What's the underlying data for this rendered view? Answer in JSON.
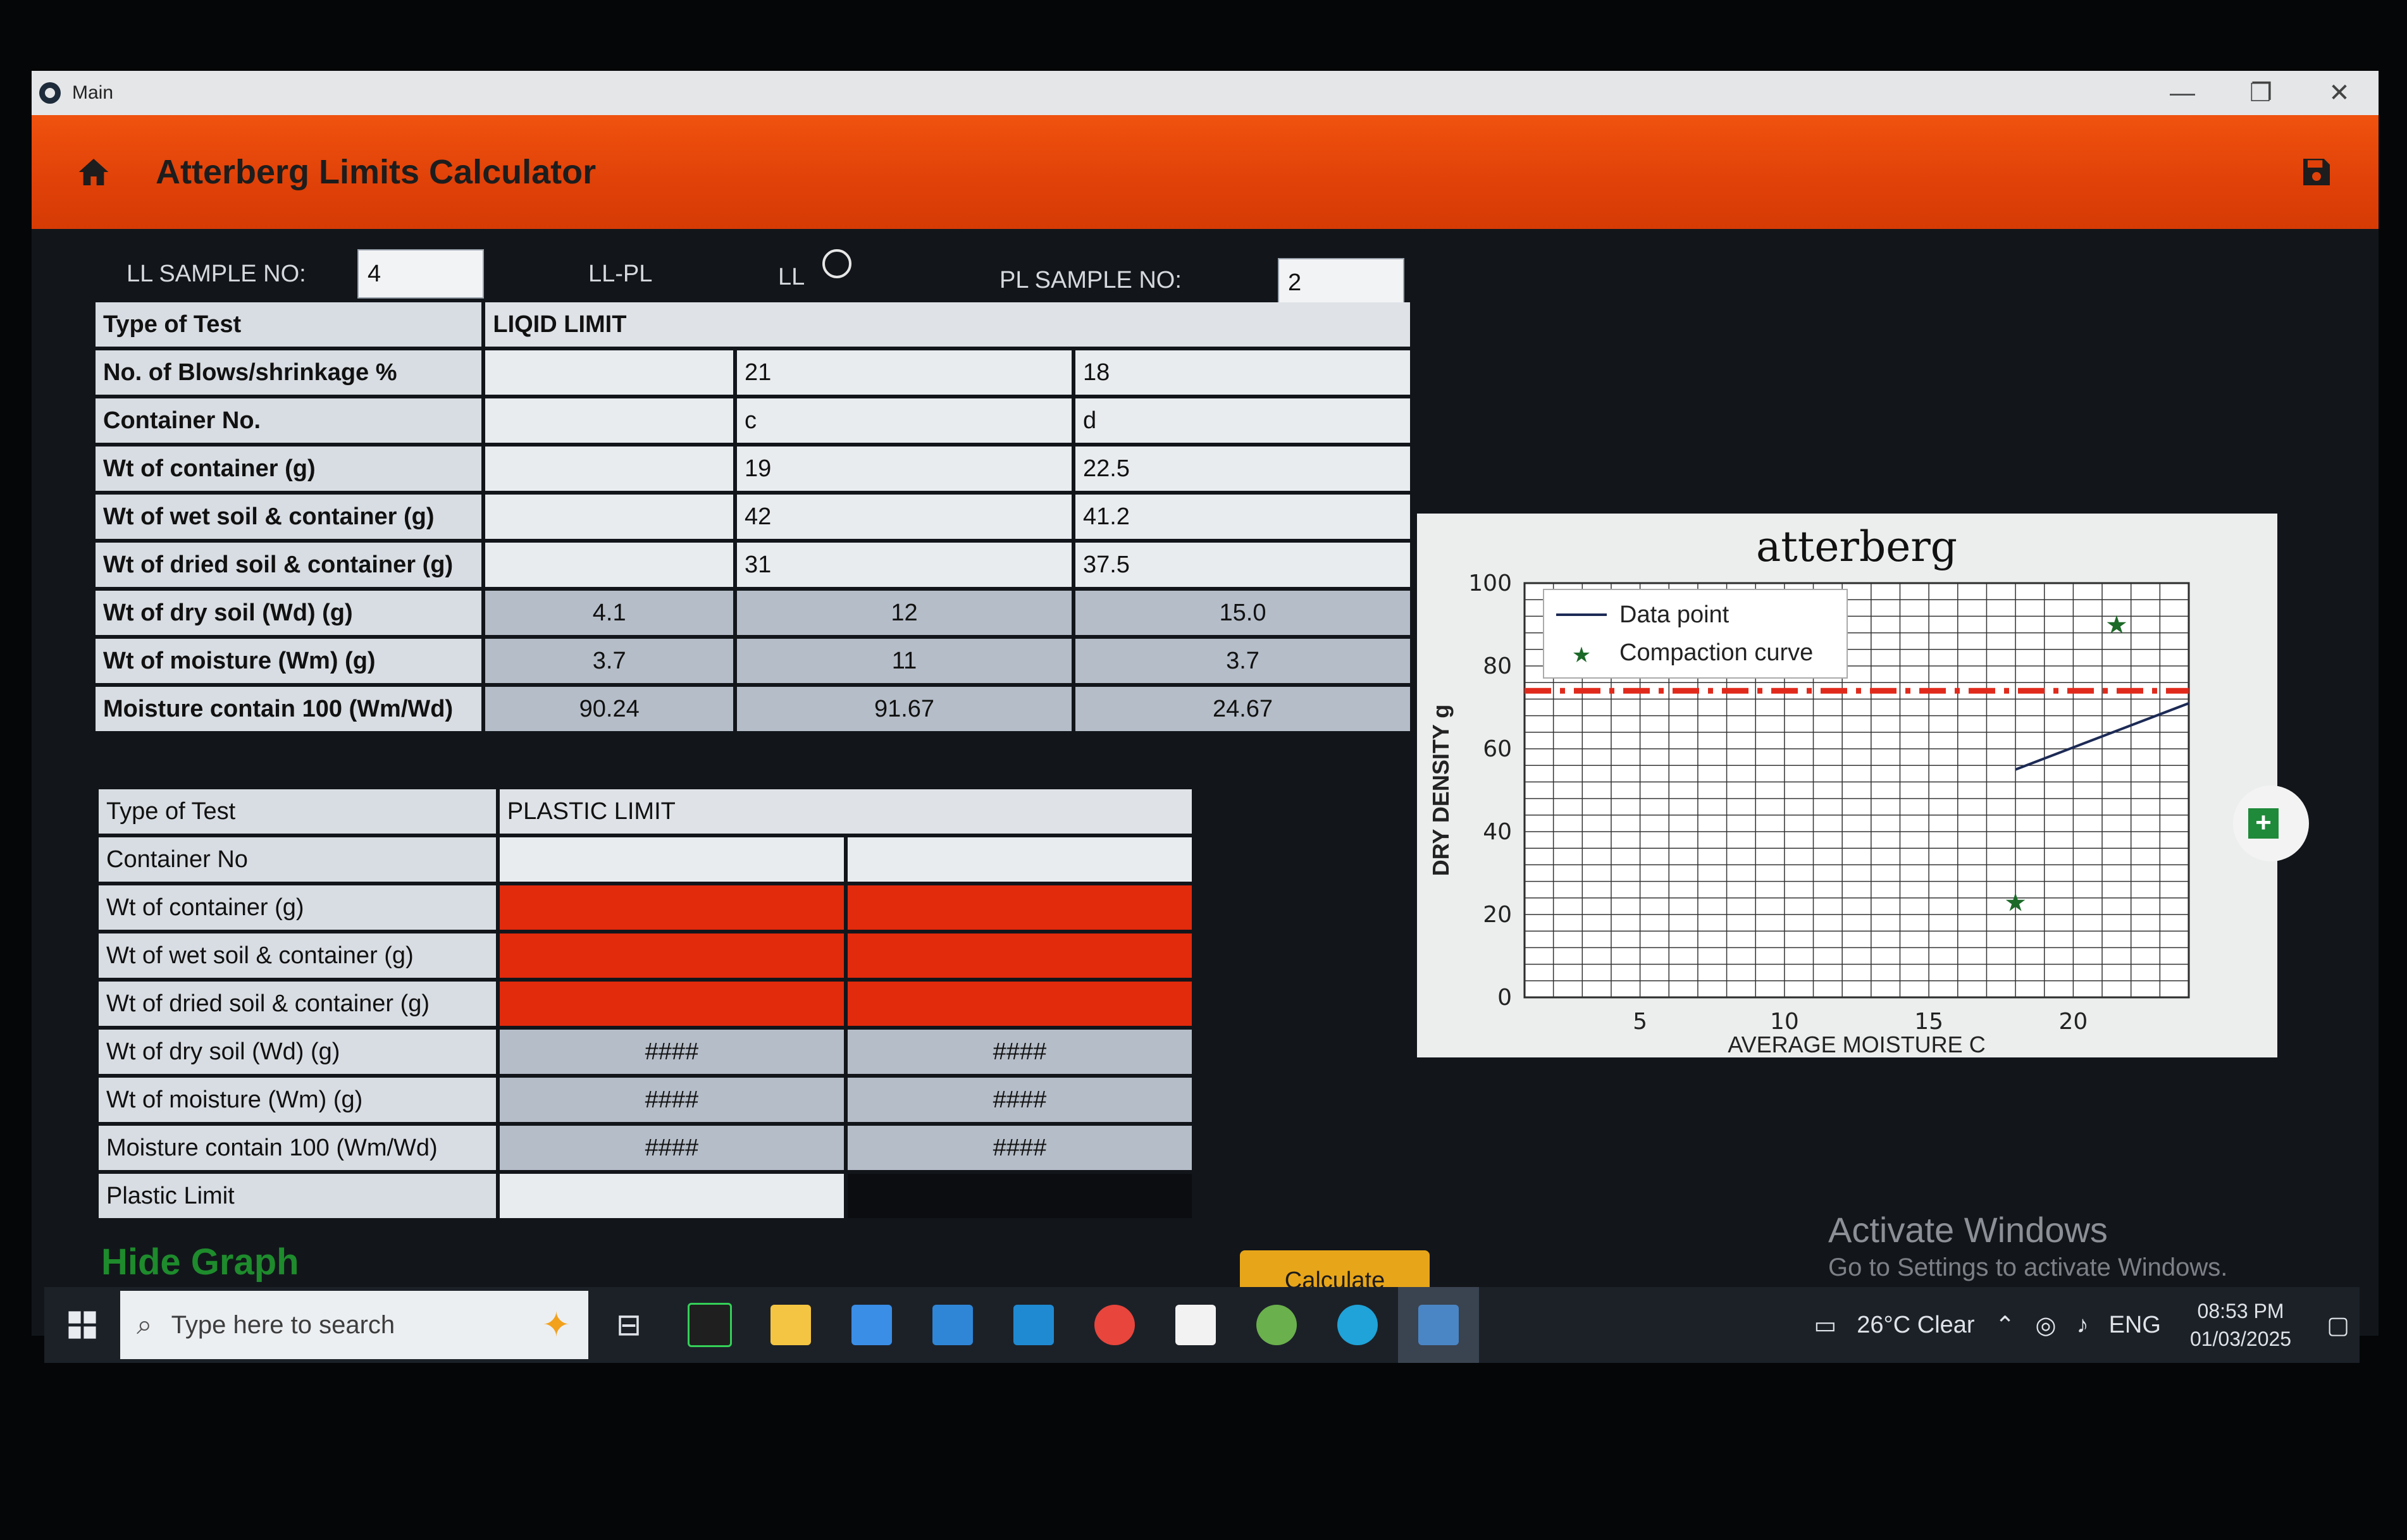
{
  "window": {
    "title": "Main",
    "controls": [
      "—",
      "❐",
      "✕"
    ]
  },
  "appbar": {
    "title": "Atterberg Limits Calculator",
    "home_icon": "home-icon",
    "save_icon": "save-icon",
    "accent_color": "#e04108"
  },
  "samples": {
    "ll_label": "LL SAMPLE NO:",
    "ll_value": "4",
    "mode_label": "LL-PL",
    "ll_radio_label": "LL",
    "pl_label": "PL SAMPLE NO:",
    "pl_value": "2"
  },
  "ll_table": {
    "type_label": "Type of Test",
    "type_value": "LIQID LIMIT",
    "rows": [
      {
        "label": "No. of Blows/shrinkage %",
        "values": [
          "",
          "21",
          "18"
        ]
      },
      {
        "label": "Container No.",
        "values": [
          "",
          "c",
          "d"
        ]
      },
      {
        "label": "Wt of container (g)",
        "values": [
          "",
          "19",
          "22.5"
        ]
      },
      {
        "label": "Wt of wet soil & container (g)",
        "values": [
          "",
          "42",
          "41.2"
        ]
      },
      {
        "label": "Wt of dried soil & container (g)",
        "values": [
          "",
          "31",
          "37.5"
        ]
      },
      {
        "label": "Wt of dry soil (Wd) (g)",
        "values": [
          "4.1",
          "12",
          "15.0"
        ]
      },
      {
        "label": "Wt of moisture (Wm) (g)",
        "values": [
          "3.7",
          "11",
          "3.7"
        ]
      },
      {
        "label": "Moisture contain 100 (Wm/Wd)",
        "values": [
          "90.24",
          "91.67",
          "24.67"
        ]
      }
    ]
  },
  "pl_table": {
    "type_label": "Type of Test",
    "type_value": "PLASTIC LIMIT",
    "rows": [
      {
        "label": "Container No",
        "values": [
          "",
          ""
        ]
      },
      {
        "label": "Wt of container (g)",
        "values": [
          "",
          ""
        ]
      },
      {
        "label": "Wt of wet soil & container (g)",
        "values": [
          "",
          ""
        ]
      },
      {
        "label": "Wt of dried soil & container (g)",
        "values": [
          "",
          ""
        ]
      },
      {
        "label": "Wt of dry soil (Wd) (g)",
        "values": [
          "####",
          "####"
        ]
      },
      {
        "label": "Wt of moisture (Wm) (g)",
        "values": [
          "####",
          "####"
        ]
      },
      {
        "label": "Moisture contain 100 (Wm/Wd)",
        "values": [
          "####",
          "####"
        ]
      },
      {
        "label": "Plastic Limit",
        "values": [
          "",
          ""
        ]
      }
    ],
    "error_color": "#e22a0c"
  },
  "chart_data": {
    "type": "line",
    "title": "atterberg",
    "xlabel": "AVERAGE MOISTURE C",
    "ylabel": "DRY DENSITY g",
    "xlim": [
      1,
      24
    ],
    "ylim": [
      0,
      100
    ],
    "xticks": [
      5,
      10,
      15,
      20
    ],
    "yticks": [
      0,
      20,
      40,
      60,
      80,
      100
    ],
    "grid": true,
    "legend_position": "top-left",
    "legend": [
      "Data point",
      "Compaction curve"
    ],
    "series": [
      {
        "name": "Data point",
        "x": [
          18,
          24
        ],
        "y": [
          55,
          71
        ],
        "color": "#1c2a55"
      },
      {
        "name": "Compaction curve",
        "x": [
          18,
          21.5
        ],
        "y": [
          23,
          90
        ],
        "color": "#1c6a28"
      }
    ],
    "reference_line": {
      "y": 74,
      "color": "#e02a1c"
    }
  },
  "actions": {
    "hide_graph": "Hide Graph",
    "calculate": "Calculate"
  },
  "watermark": {
    "line1": "Activate Windows",
    "line2": "Go to Settings to activate Windows."
  },
  "taskbar": {
    "search_placeholder": "Type here to search",
    "weather": "26°C  Clear",
    "language": "ENG",
    "time": "08:53 PM",
    "date": "01/03/2025"
  }
}
